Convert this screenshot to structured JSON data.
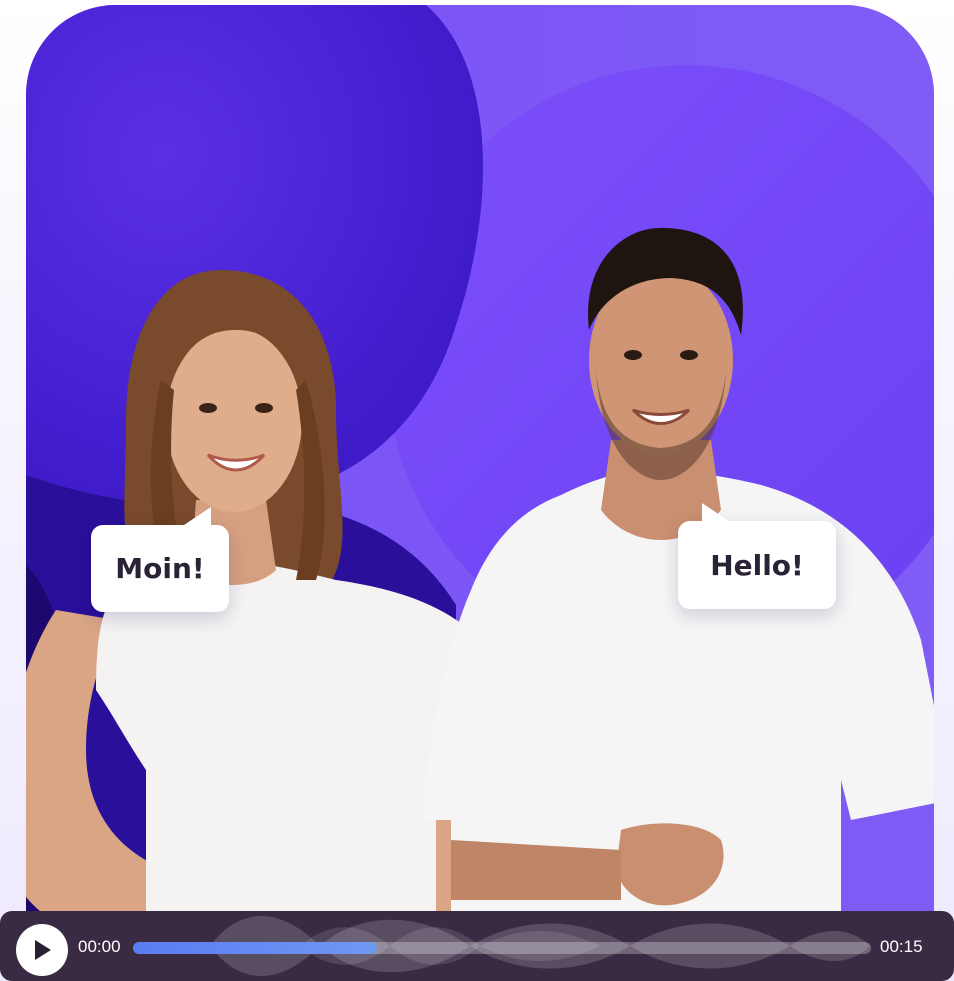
{
  "speech": {
    "left": "Moin!",
    "right": "Hello!"
  },
  "player": {
    "current_time": "00:00",
    "total_time": "00:15",
    "progress_percent": 33,
    "play_icon": "play-icon"
  },
  "colors": {
    "accent": "#6c49f5",
    "player_bg": "#3a2b44",
    "progress_fill": "#5a7cf2"
  }
}
